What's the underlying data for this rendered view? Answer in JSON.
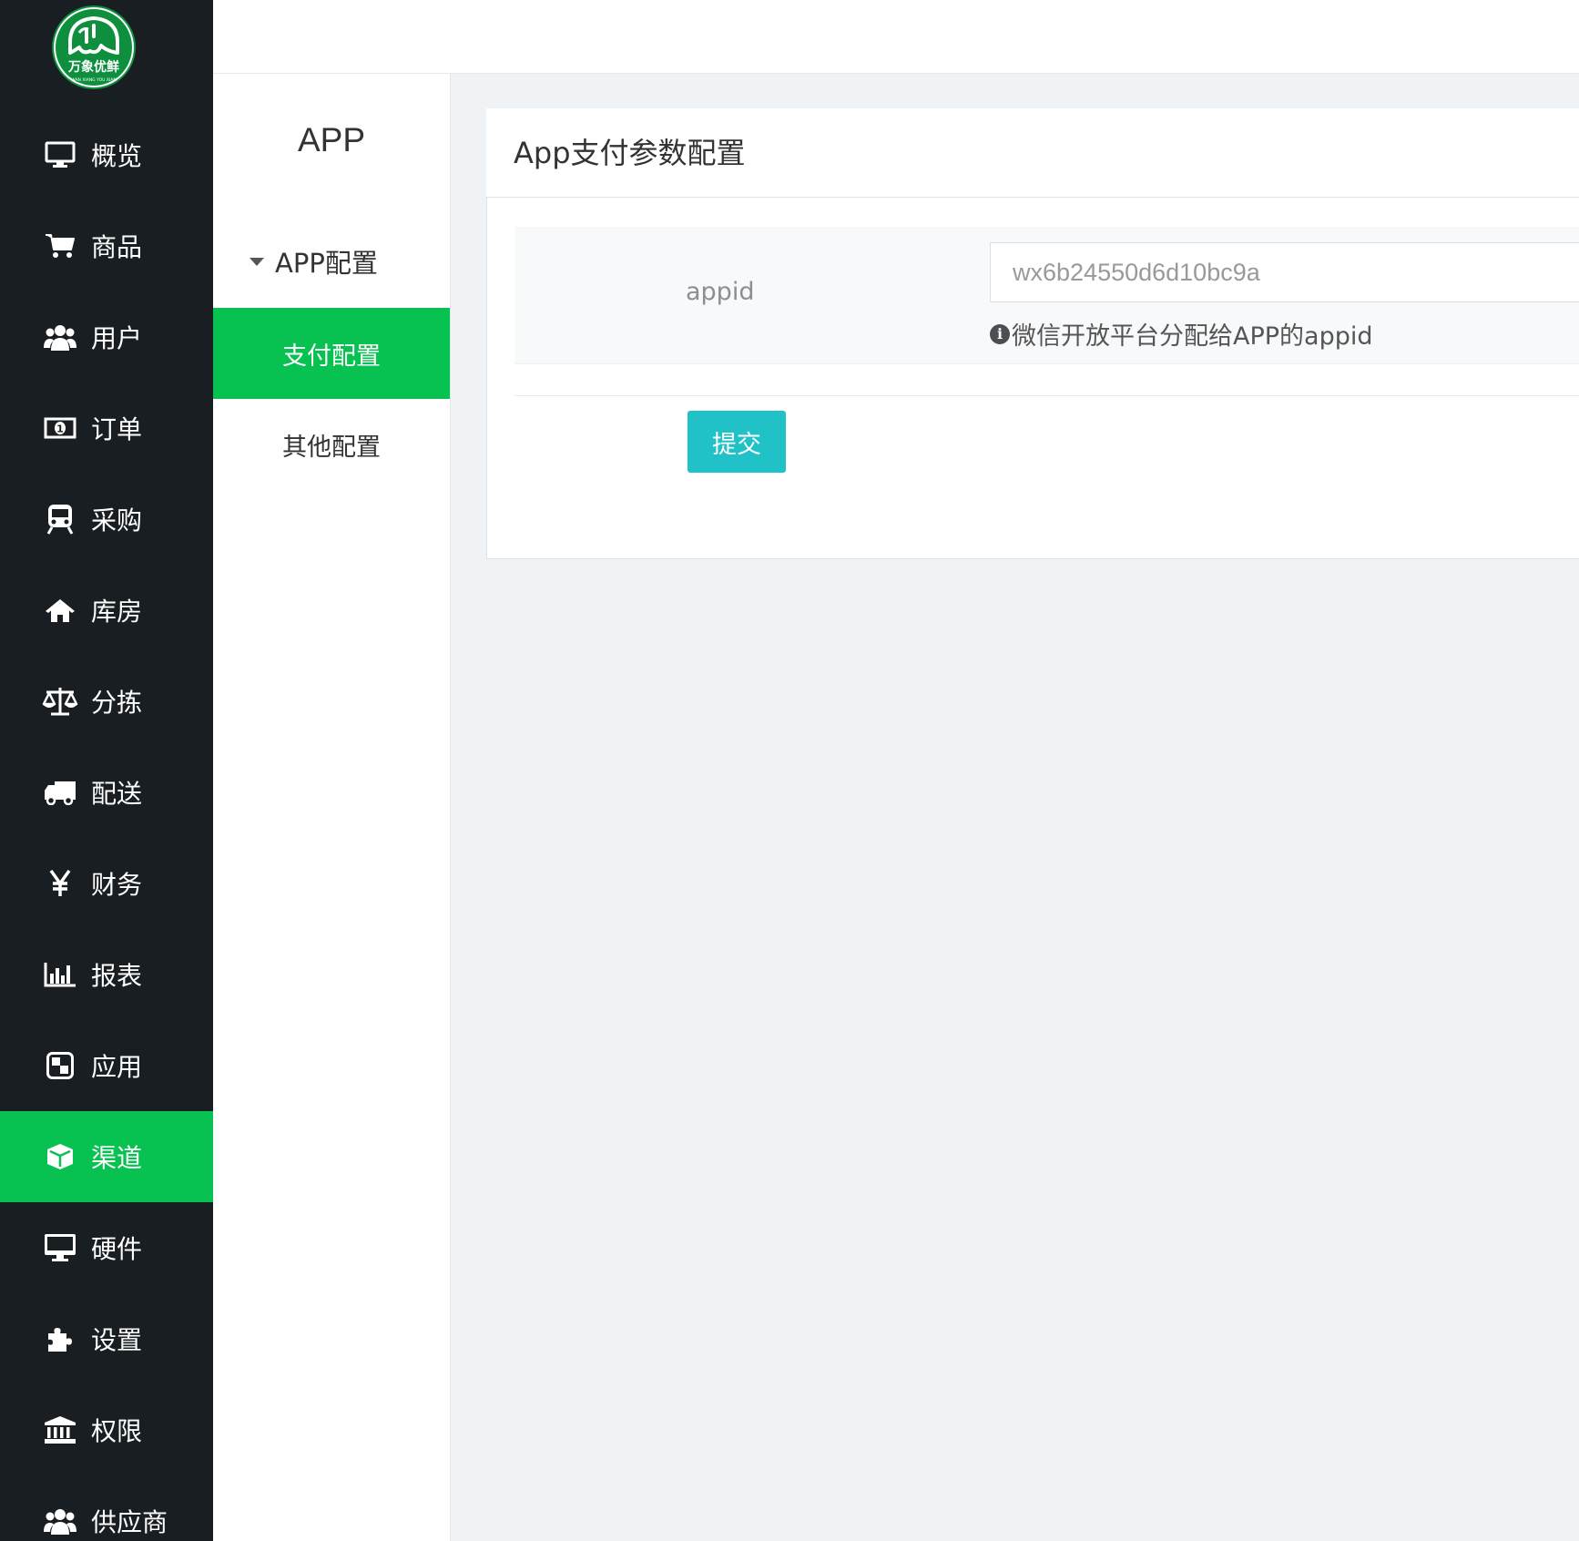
{
  "sidebar": {
    "brand": {
      "name": "万象优鲜",
      "tagline": "WAN XIANG YOU XIAN",
      "color": "#0e8f3e"
    },
    "active_color": "#07c150",
    "items": [
      {
        "label": "概览",
        "icon": "monitor-icon"
      },
      {
        "label": "商品",
        "icon": "cart-icon"
      },
      {
        "label": "用户",
        "icon": "users-icon"
      },
      {
        "label": "订单",
        "icon": "money-icon"
      },
      {
        "label": "采购",
        "icon": "train-icon"
      },
      {
        "label": "库房",
        "icon": "home-icon"
      },
      {
        "label": "分拣",
        "icon": "balance-scale-icon"
      },
      {
        "label": "配送",
        "icon": "truck-icon"
      },
      {
        "label": "财务",
        "icon": "yen-icon"
      },
      {
        "label": "报表",
        "icon": "bar-chart-icon"
      },
      {
        "label": "应用",
        "icon": "squares-icon"
      },
      {
        "label": "渠道",
        "icon": "cube-icon",
        "active": true
      },
      {
        "label": "硬件",
        "icon": "desktop-icon"
      },
      {
        "label": "设置",
        "icon": "puzzle-icon"
      },
      {
        "label": "权限",
        "icon": "bank-icon"
      },
      {
        "label": "供应商",
        "icon": "users-icon"
      }
    ]
  },
  "subnav": {
    "title": "APP",
    "group_label": "APP配置",
    "items": [
      {
        "label": "支付配置",
        "active": true
      },
      {
        "label": "其他配置",
        "active": false
      }
    ]
  },
  "panel": {
    "title": "App支付参数配置",
    "field": {
      "label": "appid",
      "value": "wx6b24550d6d10bc9a",
      "help": "微信开放平台分配给APP的appid"
    },
    "submit_label": "提交",
    "submit_color": "#20c2c8"
  }
}
